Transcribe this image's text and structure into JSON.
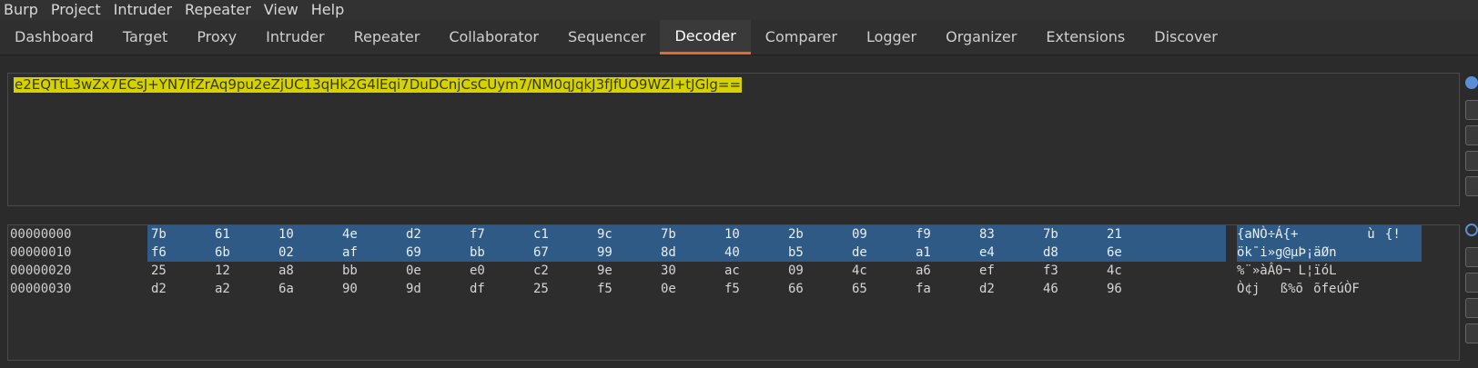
{
  "menu": [
    "Burp",
    "Project",
    "Intruder",
    "Repeater",
    "View",
    "Help"
  ],
  "tabs": [
    "Dashboard",
    "Target",
    "Proxy",
    "Intruder",
    "Repeater",
    "Collaborator",
    "Sequencer",
    "Decoder",
    "Comparer",
    "Logger",
    "Organizer",
    "Extensions",
    "Discover"
  ],
  "active_tab": "Decoder",
  "input": {
    "text": "e2EQTtL3wZx7ECsJ+YN7IfZrAq9pu2eZjUC13qHk2G4lEqi7DuDCnjCsCUym7/NM0qJqkJ3fJfUO9WZl+tJGlg=="
  },
  "hex_view": {
    "rows": [
      {
        "offset": "00000000",
        "bytes": [
          "7b",
          "61",
          "10",
          "4e",
          "d2",
          "f7",
          "c1",
          "9c",
          "7b",
          "10",
          "2b",
          "09",
          "f9",
          "83",
          "7b",
          "21"
        ],
        "ascii": "{a\u0010NÒ÷Á{\u0010+\t ù{!",
        "selected": true
      },
      {
        "offset": "00000010",
        "bytes": [
          "f6",
          "6b",
          "02",
          "af",
          "69",
          "bb",
          "67",
          "99",
          "8d",
          "40",
          "b5",
          "de",
          "a1",
          "e4",
          "d8",
          "6e"
        ],
        "ascii": "ök\u0002¯i»g@µÞ¡äØn",
        "selected": true
      },
      {
        "offset": "00000020",
        "bytes": [
          "25",
          "12",
          "a8",
          "bb",
          "0e",
          "e0",
          "c2",
          "9e",
          "30",
          "ac",
          "09",
          "4c",
          "a6",
          "ef",
          "f3",
          "4c"
        ],
        "ascii": "%\u0012¨»\u000eàÂ0¬\tL¦ïóL",
        "selected": false
      },
      {
        "offset": "00000030",
        "bytes": [
          "d2",
          "a2",
          "6a",
          "90",
          "9d",
          "df",
          "25",
          "f5",
          "0e",
          "f5",
          "66",
          "65",
          "fa",
          "d2",
          "46",
          "96"
        ],
        "ascii": "Ò¢jß%õ\u000eõfeúÒF",
        "selected": false
      }
    ]
  },
  "colors": {
    "accent": "#e8692c",
    "highlight": "#d6d200",
    "selection": "#2f5a85"
  }
}
